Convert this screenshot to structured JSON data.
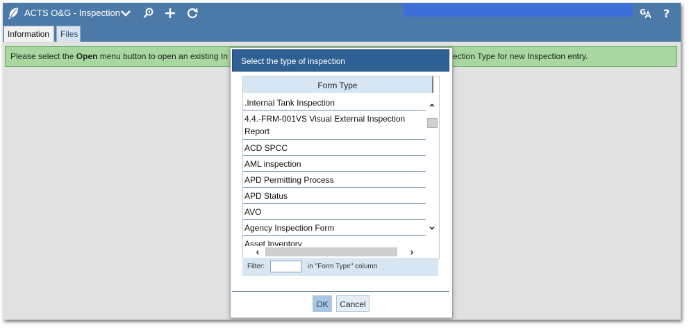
{
  "app": {
    "title": "ACTS O&G - Inspection"
  },
  "toolbar": {
    "icons": [
      "leaf-icon",
      "chevron-down-icon",
      "search-location-icon",
      "plus-icon",
      "refresh-icon",
      "translate-icon",
      "help-icon"
    ]
  },
  "tabs": [
    {
      "label": "Information",
      "active": true
    },
    {
      "label": "Files",
      "active": false
    }
  ],
  "message": {
    "part1": "Please select the ",
    "bold": "Open",
    "part2": " menu button to open an existing In",
    "part3": "ection Type for new Inspection entry."
  },
  "dialog": {
    "title": "Select the type of inspection",
    "column_header": "Form Type",
    "rows": [
      ".Internal Tank Inspection",
      "4.4.-FRM-001VS Visual External Inspection Report",
      "ACD SPCC",
      "AML inspection",
      "APD Permitting Process",
      "APD Status",
      "AVO",
      "Agency Inspection Form",
      "Asset Inventory"
    ],
    "filter_label": "Filter:",
    "filter_value": "",
    "filter_hint": "in \"Form Type\" column",
    "ok_label": "OK",
    "cancel_label": "Cancel"
  },
  "colors": {
    "topbar": "#4b7aa8",
    "dialog_title": "#2e6096",
    "message_bg": "#a8d8a0",
    "header_bg": "#d6e6f2"
  }
}
